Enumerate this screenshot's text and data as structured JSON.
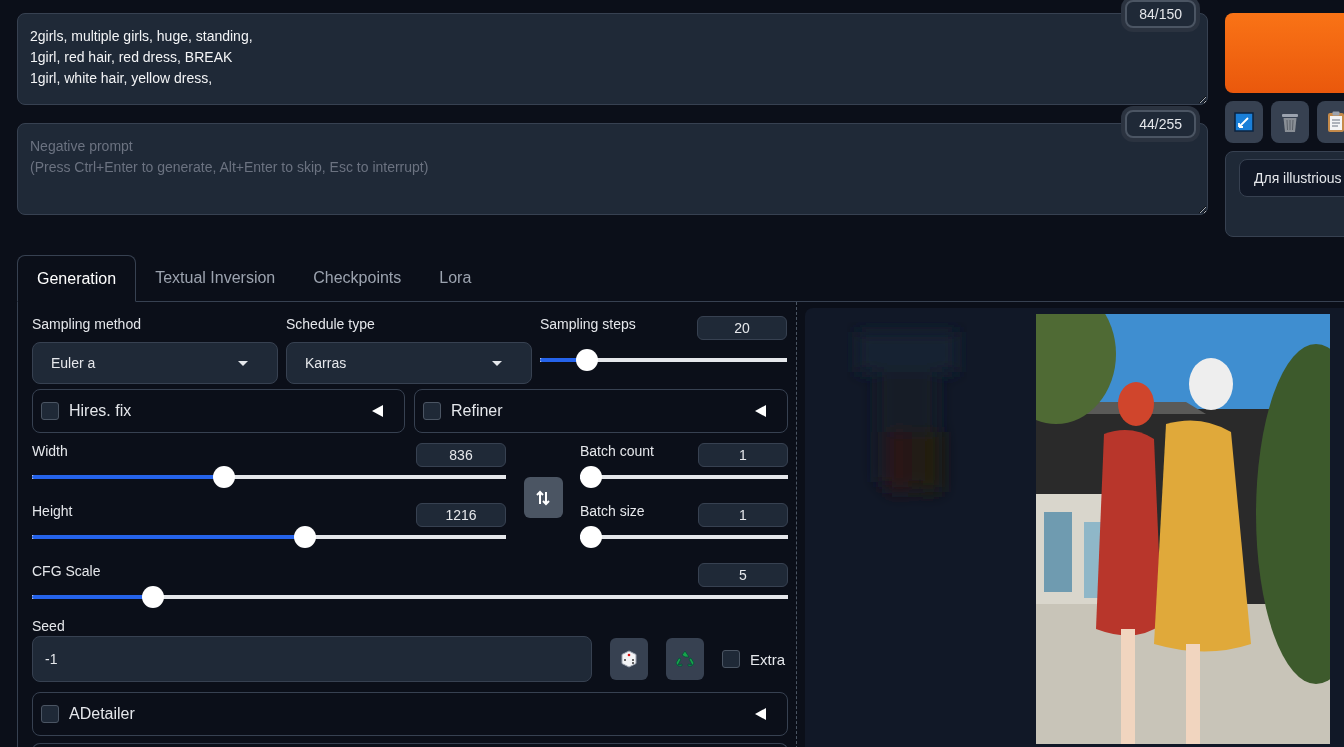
{
  "prompt": {
    "value": "2girls, multiple girls, huge, standing,\n1girl, red hair, red dress, BREAK\n1girl, white hair, yellow dress,",
    "token_count": "84/150"
  },
  "negative_prompt": {
    "placeholder": "Negative prompt\n(Press Ctrl+Enter to generate, Alt+Enter to skip, Esc to interrupt)",
    "token_count": "44/255"
  },
  "styles": {
    "value": "Для illustrious"
  },
  "tabs": [
    {
      "label": "Generation",
      "selected": true
    },
    {
      "label": "Textual Inversion",
      "selected": false
    },
    {
      "label": "Checkpoints",
      "selected": false
    },
    {
      "label": "Lora",
      "selected": false
    }
  ],
  "sampling_method": {
    "label": "Sampling method",
    "value": "Euler a"
  },
  "schedule_type": {
    "label": "Schedule type",
    "value": "Karras"
  },
  "sampling_steps": {
    "label": "Sampling steps",
    "value": "20",
    "level": 0.16
  },
  "accordions_top": [
    {
      "label": "Hires. fix",
      "checked": false
    },
    {
      "label": "Refiner",
      "checked": false
    }
  ],
  "size_sliders": [
    {
      "label": "Width",
      "value": "836",
      "level": 0.4
    },
    {
      "label": "Height",
      "value": "1216",
      "level": 0.58
    }
  ],
  "batch_sliders": [
    {
      "label": "Batch count",
      "value": "1",
      "level": 0
    },
    {
      "label": "Batch size",
      "value": "1",
      "level": 0
    }
  ],
  "cfg_scale": {
    "label": "CFG Scale",
    "value": "5",
    "level": 0.15
  },
  "seed": {
    "label": "Seed",
    "value": "-1"
  },
  "extra": {
    "label": "Extra",
    "checked": false
  },
  "adetailer": {
    "label": "ADetailer",
    "checked": false
  }
}
